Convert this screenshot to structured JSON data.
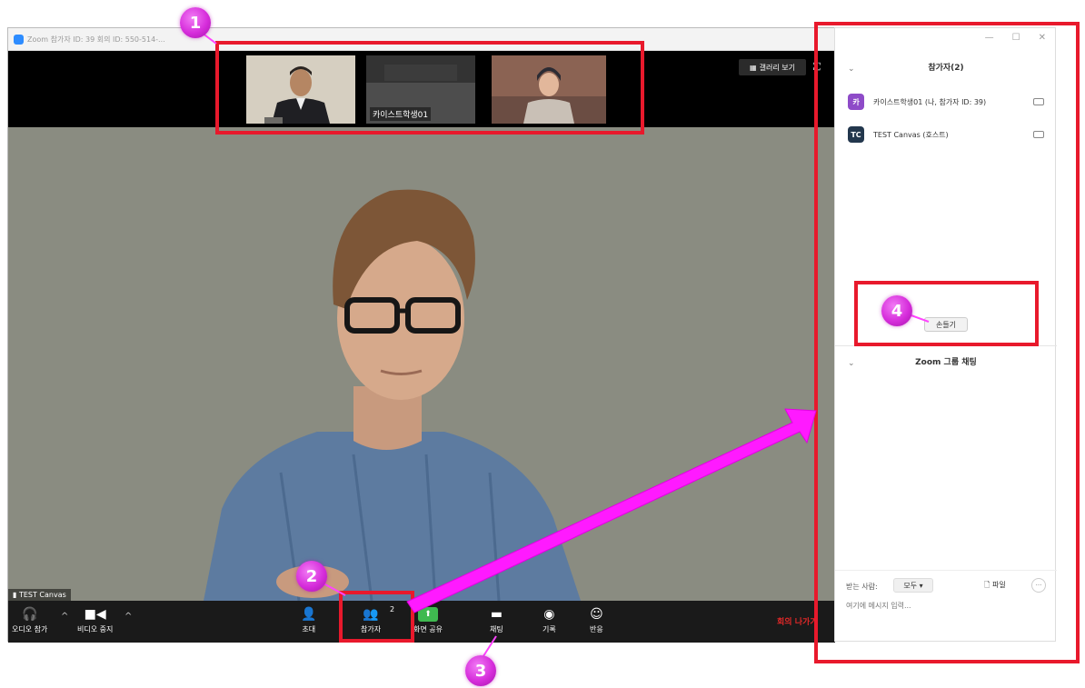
{
  "window": {
    "title": "Zoom 참가자 ID: 39   회의 ID: 550-514-..."
  },
  "thumbnails": [
    {
      "label": ""
    },
    {
      "label": "카이스트학생01"
    },
    {
      "label": ""
    }
  ],
  "gallery_view_label": "갤러리 보기",
  "main_video": {
    "name_tag": "TEST Canvas"
  },
  "toolbar": {
    "audio_label": "오디오 참가",
    "video_label": "비디오 중지",
    "invite_label": "초대",
    "participants_label": "참가자",
    "participants_count": "2",
    "share_label": "화면 공유",
    "chat_label": "채팅",
    "record_label": "기록",
    "reactions_label": "반응",
    "leave_label": "회의 나가기"
  },
  "side_panel": {
    "participants_header": "참가자(2)",
    "participants": [
      {
        "initials": "카",
        "name": "카이스트학생01 (나, 참가자 ID: 39)",
        "color": "#8e4bc8"
      },
      {
        "initials": "TC",
        "name": "TEST Canvas (호스트)",
        "color": "#23374d"
      }
    ],
    "raise_hand_label": "손들기",
    "chat_header": "Zoom 그룹 채팅",
    "to_label": "받는 사람:",
    "to_value": "모두",
    "file_label": "파일",
    "more_label": "···",
    "chat_placeholder": "여기에 메시지 입력..."
  },
  "annotations": {
    "badge1": "1",
    "badge2": "2",
    "badge3": "3",
    "badge4": "4",
    "colors": {
      "box": "#e8192c",
      "arrow": "#ff00ff",
      "badge": "#d62ddb"
    }
  }
}
